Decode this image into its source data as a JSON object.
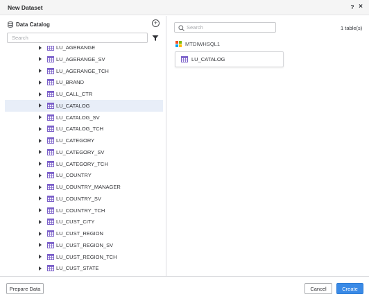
{
  "dialog": {
    "title": "New Dataset",
    "help_label": "?",
    "close_label": "×"
  },
  "left_panel": {
    "title": "Data Catalog",
    "search_placeholder": "Search",
    "add_icon": "plus-circle-icon",
    "filter_icon": "filter-icon",
    "tree_items": [
      {
        "label": "LU_AGERANGE",
        "selected": false
      },
      {
        "label": "LU_AGERANGE_SV",
        "selected": false
      },
      {
        "label": "LU_AGERANGE_TCH",
        "selected": false
      },
      {
        "label": "LU_BRAND",
        "selected": false
      },
      {
        "label": "LU_CALL_CTR",
        "selected": false
      },
      {
        "label": "LU_CATALOG",
        "selected": true
      },
      {
        "label": "LU_CATALOG_SV",
        "selected": false
      },
      {
        "label": "LU_CATALOG_TCH",
        "selected": false
      },
      {
        "label": "LU_CATEGORY",
        "selected": false
      },
      {
        "label": "LU_CATEGORY_SV",
        "selected": false
      },
      {
        "label": "LU_CATEGORY_TCH",
        "selected": false
      },
      {
        "label": "LU_COUNTRY",
        "selected": false
      },
      {
        "label": "LU_COUNTRY_MANAGER",
        "selected": false
      },
      {
        "label": "LU_COUNTRY_SV",
        "selected": false
      },
      {
        "label": "LU_COUNTRY_TCH",
        "selected": false
      },
      {
        "label": "LU_CUST_CITY",
        "selected": false
      },
      {
        "label": "LU_CUST_REGION",
        "selected": false
      },
      {
        "label": "LU_CUST_REGION_SV",
        "selected": false
      },
      {
        "label": "LU_CUST_REGION_TCH",
        "selected": false
      },
      {
        "label": "LU_CUST_STATE",
        "selected": false
      }
    ]
  },
  "right_panel": {
    "search_placeholder": "Search",
    "table_count": "1 table(s)",
    "source_name": "MTDIWHSQL1",
    "source_icon": "microsoft-windows-icon",
    "tables": [
      {
        "label": "LU_CATALOG",
        "icon": "table-grid-icon"
      }
    ]
  },
  "footer": {
    "prepare_label": "Prepare Data",
    "cancel_label": "Cancel",
    "create_label": "Create"
  },
  "colors": {
    "accent": "#3a8ae6",
    "selected_row": "#e8eef8",
    "table_icon": "#7a5fc9",
    "ms_red": "#f25022",
    "ms_green": "#7fba00",
    "ms_blue": "#00a4ef",
    "ms_yellow": "#ffb900"
  }
}
